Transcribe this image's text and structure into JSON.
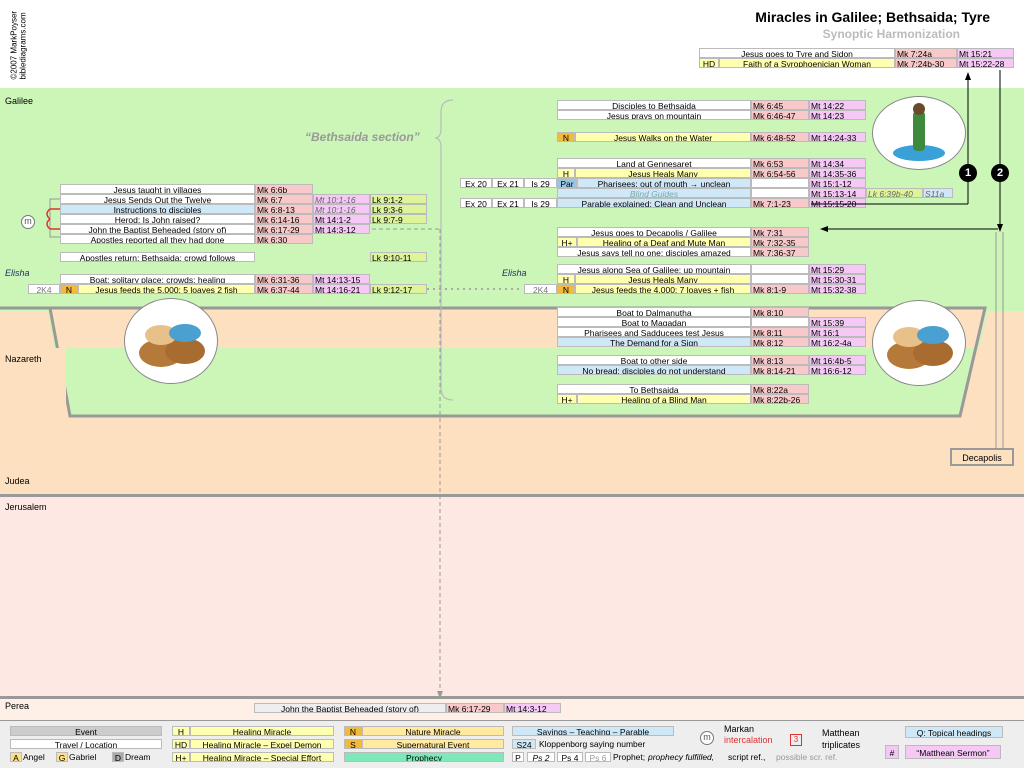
{
  "header": {
    "title": "Miracles in Galilee; Bethsaida; Tyre",
    "subtitle": "Synoptic Harmonization",
    "credit1": "©2007 MarkPoyser",
    "credit2": "biblediagrams.com"
  },
  "regions": {
    "galilee": "Galilee",
    "nazareth": "Nazareth",
    "judea": "Judea",
    "jerusalem": "Jerusalem",
    "perea": "Perea",
    "decapolis": "Decapolis"
  },
  "section_label": "“Bethsaida section”",
  "elisha": "Elisha",
  "tyre": [
    {
      "ev": "Jesus goes to Tyre and Sidon",
      "tag": "",
      "mk": "Mk 7:24a",
      "mt": "Mt 15:21"
    },
    {
      "ev": "Faith of a Syrophoenician Woman",
      "tag": "HD",
      "mk": "Mk 7:24b-30",
      "mt": "Mt 15:22-28"
    }
  ],
  "left": {
    "villages": {
      "ev": "Jesus taught in villages",
      "mk": "Mk 6:6b"
    },
    "twelve": {
      "ev": "Jesus Sends Out the Twelve",
      "mk": "Mk 6:7",
      "mt": "Mt 10:1-16",
      "lk": "Lk 9:1-2"
    },
    "instructions": {
      "ev": "Instructions to disciples",
      "mk": "Mk 6:8-13",
      "mt": "Mt 10:1-16",
      "lk": "Lk 9:3-6"
    },
    "herod": {
      "ev": "Herod: Is John raised?",
      "mk": "Mk 6:14-16",
      "mt": "Mt 14:1-2",
      "lk": "Lk 9:7-9"
    },
    "baptist": {
      "ev": "John the Baptist Beheaded (story of)",
      "mk": "Mk 6:17-29",
      "mt": "Mt 14:3-12"
    },
    "reported": {
      "ev": "Apostles reported all they had done",
      "mk": "Mk 6:30"
    },
    "return": {
      "ev": "Apostles return; Bethsaida; crowd follows",
      "lk": "Lk 9:10-11"
    },
    "boat": {
      "ev": "Boat; solitary place; crowds; healing",
      "mk": "Mk 6:31-36",
      "mt": "Mt 14:13-15"
    },
    "feeds5000": {
      "ev": "Jesus feeds the 5,000: 5 loaves 2 fish",
      "tag": "N",
      "ref": "2K4",
      "mk": "Mk 6:37-44",
      "mt": "Mt 14:16-21",
      "lk": "Lk 9:12-17"
    }
  },
  "mid": {
    "bethsaida": {
      "ev": "Disciples to Bethsaida",
      "mk": "Mk 6:45",
      "mt": "Mt 14:22"
    },
    "prays": {
      "ev": "Jesus prays on mountain",
      "mk": "Mk 6:46-47",
      "mt": "Mt 14:23"
    },
    "walks": {
      "ev": "Jesus Walks on the Water",
      "tag": "N",
      "mk": "Mk 6:48-52",
      "mt": "Mt 14:24-33"
    },
    "gennesaret": {
      "ev": "Land at Gennesaret",
      "mk": "Mk 6:53",
      "mt": "Mt 14:34"
    },
    "healsmany": {
      "ev": "Jesus Heals Many",
      "tag": "H",
      "mk": "Mk 6:54-56",
      "mt": "Mt 14:35-36"
    },
    "pharisees": {
      "ev": "Pharisees; out of mouth → unclean",
      "tag": "Par",
      "refs": [
        "Ex 20",
        "Ex 21",
        "Is 29"
      ],
      "mt": "Mt 15:1-12"
    },
    "blind": {
      "ev": "Blind Guides",
      "mt": "Mt 15:13-14",
      "lk": "Lk 6:39b-40",
      "s": "S11a"
    },
    "parable": {
      "ev": "Parable explained: Clean and Unclean",
      "refs": [
        "Ex 20",
        "Ex 21",
        "Is 29"
      ],
      "mk": "Mk 7:1-23",
      "mt": "Mt 15:15-20"
    },
    "decapolis": {
      "ev": "Jesus goes to Decapolis / Galilee",
      "mk": "Mk 7:31"
    },
    "deaf": {
      "ev": "Healing of a Deaf and Mute Man",
      "tag": "H+",
      "mk": "Mk 7:32-35"
    },
    "tellno": {
      "ev": "Jesus says tell no one; disciples amazed",
      "mk": "Mk 7:36-37"
    },
    "seagalilee": {
      "ev": "Jesus along Sea of Galilee; up mountain",
      "mt": "Mt 15:29"
    },
    "healsmany2": {
      "ev": "Jesus Heals Many",
      "tag": "H",
      "mt": "Mt 15:30-31"
    },
    "feeds4000": {
      "ev": "Jesus feeds the 4,000: 7 loaves + fish",
      "tag": "N",
      "ref": "2K4",
      "mk": "Mk 8:1-9",
      "mt": "Mt 15:32-38"
    },
    "dalmanutha": {
      "ev": "Boat to Dalmanutha",
      "mk": "Mk 8:10"
    },
    "magadan": {
      "ev": "Boat to Magadan",
      "mt": "Mt 15:39"
    },
    "sadducees": {
      "ev": "Pharisees and Sadducees test Jesus",
      "mk": "Mk 8:11",
      "mt": "Mt 16:1"
    },
    "sign": {
      "ev": "The Demand for a Sign",
      "mk": "Mk 8:12",
      "mt": "Mt 16:2-4a"
    },
    "otherside": {
      "ev": "Boat to other side",
      "mk": "Mk 8:13",
      "mt": "Mt 16:4b-5"
    },
    "nobread": {
      "ev": "No bread; disciples do not understand",
      "mk": "Mk 8:14-21",
      "mt": "Mt 16:6-12"
    },
    "tobethsaida": {
      "ev": "To Bethsaida",
      "mk": "Mk 8:22a"
    },
    "blindman": {
      "ev": "Healing of a Blind Man",
      "tag": "H+",
      "mk": "Mk 8:22b-26"
    }
  },
  "perea_row": {
    "ev": "John the Baptist Beheaded (story of)",
    "mk": "Mk 6:17-29",
    "mt": "Mt 14:3-12"
  },
  "markers": {
    "m": "m",
    "one": "1",
    "two": "2"
  },
  "legend": {
    "event": "Event",
    "travel": "Travel / Location",
    "angel_tag": "A",
    "angel": "Angel",
    "gabriel_tag": "G",
    "gabriel": "Gabriel",
    "dream_tag": "D",
    "dream": "Dream",
    "h_tag": "H",
    "h": "Healing Miracle",
    "hd_tag": "HD",
    "hd": "Healing Miracle – Expel Demon",
    "hp_tag": "H+",
    "hp": "Healing Miracle – Special Effort",
    "n_tag": "N",
    "n": "Nature Miracle",
    "s_tag": "S",
    "s": "Supernatural Event",
    "prophecy": "Prophecy",
    "sayings": "Sayings – Teaching – Parable",
    "s24_tag": "S24",
    "s24": "Kloppenborg saying number",
    "p_tag": "P",
    "ps2": "Ps 2",
    "ps4": "Ps 4",
    "ps6": "Ps 6",
    "prophet": "Prophet;",
    "prophet_fulfil": "prophecy fulfilled,",
    "script_ref": "script ref.,",
    "possible": "possible scr. ref.",
    "markan": "Markan",
    "intercalation": "intercalation",
    "m_tag": "m",
    "matthean": "Matthean",
    "triplicates": "triplicates",
    "three_tag": "3",
    "topical": "Q: Topical headings",
    "hash": "#",
    "sermon": "“Matthean Sermon”"
  },
  "colors": {
    "galilee": "#ccf5b8",
    "judea": "#fde0bf",
    "jerusalem": "#fde8e4",
    "perea": "#fef0e6",
    "mk": "#f9c9c9",
    "mt": "#f6c8f6",
    "lk": "#dcf59a"
  }
}
